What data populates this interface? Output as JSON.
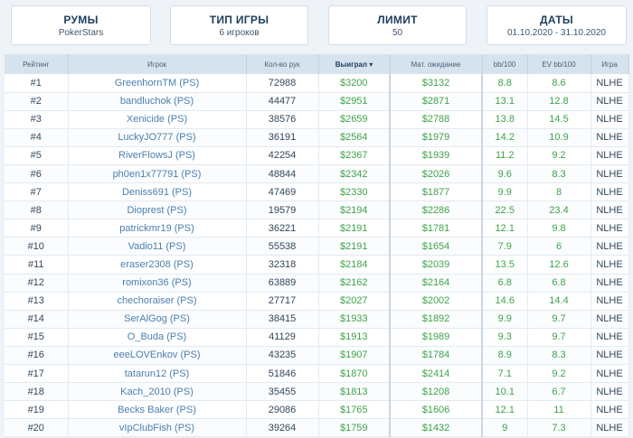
{
  "filters": {
    "rooms": {
      "title": "РУМЫ",
      "value": "PokerStars"
    },
    "gametype": {
      "title": "ТИП ИГРЫ",
      "value": "6 игроков"
    },
    "limit": {
      "title": "ЛИМИТ",
      "value": "50"
    },
    "dates": {
      "title": "ДАТЫ",
      "value": "01.10.2020 - 31.10.2020"
    }
  },
  "table": {
    "headers": {
      "rank": "Рейтинг",
      "player": "Игрок",
      "hands": "Кол-во рук",
      "won": "Выиграл ▾",
      "ev": "Мат. ожидание",
      "bb100": "bb/100",
      "evbb100": "EV bb/100",
      "game": "Игра"
    },
    "rows": [
      {
        "rank": "#1",
        "player": "GreenhornTM (PS)",
        "hands": "72988",
        "won": "$3200",
        "ev": "$3132",
        "bb100": "8.8",
        "evbb100": "8.6",
        "game": "NLHE"
      },
      {
        "rank": "#2",
        "player": "bandluchok (PS)",
        "hands": "44477",
        "won": "$2951",
        "ev": "$2871",
        "bb100": "13.1",
        "evbb100": "12.8",
        "game": "NLHE"
      },
      {
        "rank": "#3",
        "player": "Xenicide (PS)",
        "hands": "38576",
        "won": "$2659",
        "ev": "$2788",
        "bb100": "13.8",
        "evbb100": "14.5",
        "game": "NLHE"
      },
      {
        "rank": "#4",
        "player": "LuckyJO777 (PS)",
        "hands": "36191",
        "won": "$2564",
        "ev": "$1979",
        "bb100": "14.2",
        "evbb100": "10.9",
        "game": "NLHE"
      },
      {
        "rank": "#5",
        "player": "RiverFlowsJ (PS)",
        "hands": "42254",
        "won": "$2367",
        "ev": "$1939",
        "bb100": "11.2",
        "evbb100": "9.2",
        "game": "NLHE"
      },
      {
        "rank": "#6",
        "player": "ph0en1x77791 (PS)",
        "hands": "48844",
        "won": "$2342",
        "ev": "$2026",
        "bb100": "9.6",
        "evbb100": "8.3",
        "game": "NLHE"
      },
      {
        "rank": "#7",
        "player": "Deniss691 (PS)",
        "hands": "47469",
        "won": "$2330",
        "ev": "$1877",
        "bb100": "9.9",
        "evbb100": "8",
        "game": "NLHE"
      },
      {
        "rank": "#8",
        "player": "Dioprest (PS)",
        "hands": "19579",
        "won": "$2194",
        "ev": "$2286",
        "bb100": "22.5",
        "evbb100": "23.4",
        "game": "NLHE"
      },
      {
        "rank": "#9",
        "player": "patrickmr19 (PS)",
        "hands": "36221",
        "won": "$2191",
        "ev": "$1781",
        "bb100": "12.1",
        "evbb100": "9.8",
        "game": "NLHE"
      },
      {
        "rank": "#10",
        "player": "Vadio11 (PS)",
        "hands": "55538",
        "won": "$2191",
        "ev": "$1654",
        "bb100": "7.9",
        "evbb100": "6",
        "game": "NLHE"
      },
      {
        "rank": "#11",
        "player": "eraser2308 (PS)",
        "hands": "32318",
        "won": "$2184",
        "ev": "$2039",
        "bb100": "13.5",
        "evbb100": "12.6",
        "game": "NLHE"
      },
      {
        "rank": "#12",
        "player": "romixon36 (PS)",
        "hands": "63889",
        "won": "$2162",
        "ev": "$2164",
        "bb100": "6.8",
        "evbb100": "6.8",
        "game": "NLHE"
      },
      {
        "rank": "#13",
        "player": "chechoraiser (PS)",
        "hands": "27717",
        "won": "$2027",
        "ev": "$2002",
        "bb100": "14.6",
        "evbb100": "14.4",
        "game": "NLHE"
      },
      {
        "rank": "#14",
        "player": "SerAlGog (PS)",
        "hands": "38415",
        "won": "$1933",
        "ev": "$1892",
        "bb100": "9.9",
        "evbb100": "9.7",
        "game": "NLHE"
      },
      {
        "rank": "#15",
        "player": "O_Buda (PS)",
        "hands": "41129",
        "won": "$1913",
        "ev": "$1989",
        "bb100": "9.3",
        "evbb100": "9.7",
        "game": "NLHE"
      },
      {
        "rank": "#16",
        "player": "eeeLOVEnkov (PS)",
        "hands": "43235",
        "won": "$1907",
        "ev": "$1784",
        "bb100": "8.9",
        "evbb100": "8.3",
        "game": "NLHE"
      },
      {
        "rank": "#17",
        "player": "tatarun12 (PS)",
        "hands": "51846",
        "won": "$1870",
        "ev": "$2414",
        "bb100": "7.1",
        "evbb100": "9.2",
        "game": "NLHE"
      },
      {
        "rank": "#18",
        "player": "Kach_2010 (PS)",
        "hands": "35455",
        "won": "$1813",
        "ev": "$1208",
        "bb100": "10.1",
        "evbb100": "6.7",
        "game": "NLHE"
      },
      {
        "rank": "#19",
        "player": "Becks Baker (PS)",
        "hands": "29086",
        "won": "$1765",
        "ev": "$1606",
        "bb100": "12.1",
        "evbb100": "11",
        "game": "NLHE"
      },
      {
        "rank": "#20",
        "player": "vIpClubFish (PS)",
        "hands": "39264",
        "won": "$1759",
        "ev": "$1432",
        "bb100": "9",
        "evbb100": "7.3",
        "game": "NLHE"
      }
    ]
  },
  "colors": {
    "background": "#eef3f8",
    "header_bg": "#d6e2ed",
    "link": "#4a7fae",
    "positive": "#3fa34a",
    "title": "#1d3d5c"
  }
}
